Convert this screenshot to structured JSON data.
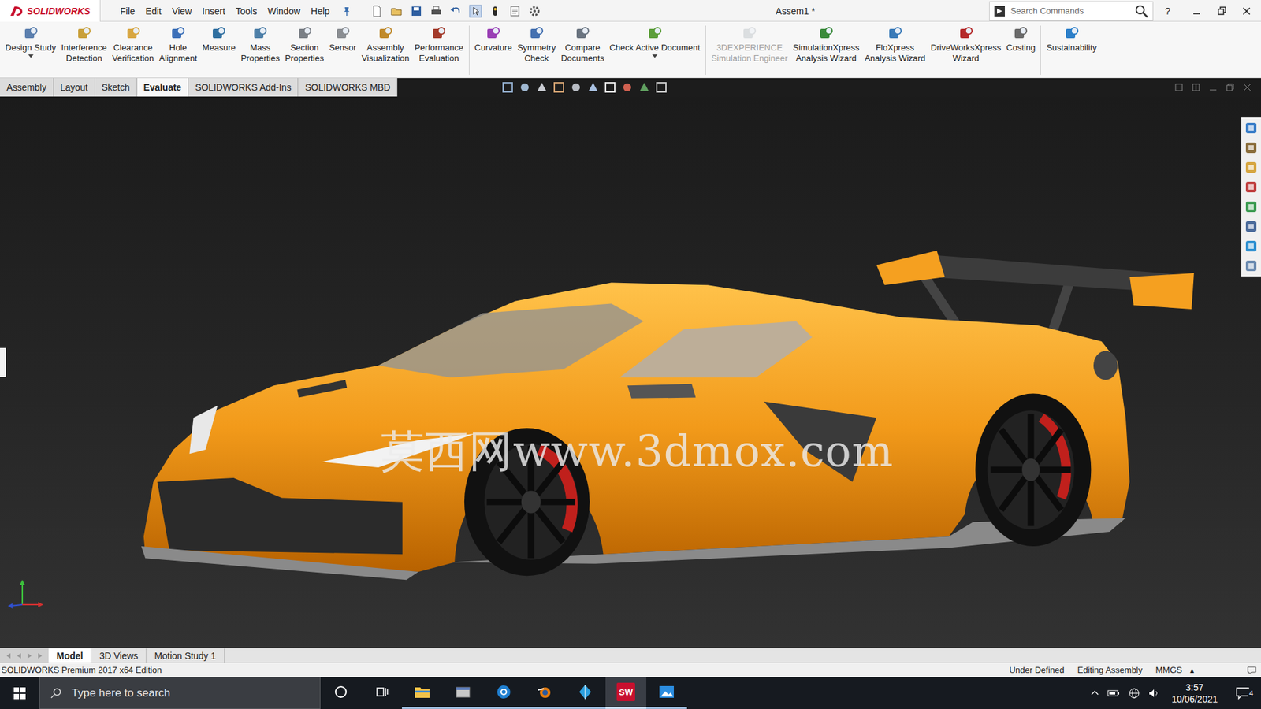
{
  "window": {
    "title": "Assem1 *"
  },
  "logo": {
    "brand": "SOLIDWORKS"
  },
  "menu": [
    {
      "label": "File"
    },
    {
      "label": "Edit"
    },
    {
      "label": "View"
    },
    {
      "label": "Insert"
    },
    {
      "label": "Tools"
    },
    {
      "label": "Window"
    },
    {
      "label": "Help"
    }
  ],
  "search": {
    "placeholder": "Search Commands"
  },
  "help": "?",
  "ribbon": {
    "groups": [
      [
        {
          "lines": [
            "Design Study"
          ],
          "dropdown": true,
          "disabled": false
        },
        {
          "lines": [
            "Interference",
            "Detection"
          ],
          "dropdown": false,
          "disabled": false
        },
        {
          "lines": [
            "Clearance",
            "Verification"
          ],
          "dropdown": false,
          "disabled": false
        },
        {
          "lines": [
            "Hole",
            "Alignment"
          ],
          "dropdown": false,
          "disabled": false
        },
        {
          "lines": [
            "Measure"
          ],
          "dropdown": false,
          "disabled": false
        },
        {
          "lines": [
            "Mass",
            "Properties"
          ],
          "dropdown": false,
          "disabled": false
        },
        {
          "lines": [
            "Section",
            "Properties"
          ],
          "dropdown": false,
          "disabled": false
        },
        {
          "lines": [
            "Sensor"
          ],
          "dropdown": false,
          "disabled": false
        },
        {
          "lines": [
            "Assembly",
            "Visualization"
          ],
          "dropdown": false,
          "disabled": false
        },
        {
          "lines": [
            "Performance",
            "Evaluation"
          ],
          "dropdown": false,
          "disabled": false
        }
      ],
      [
        {
          "lines": [
            "Curvature"
          ],
          "dropdown": false,
          "disabled": false
        },
        {
          "lines": [
            "Symmetry",
            "Check"
          ],
          "dropdown": false,
          "disabled": false
        },
        {
          "lines": [
            "Compare",
            "Documents"
          ],
          "dropdown": false,
          "disabled": false
        },
        {
          "lines": [
            "Check Active Document"
          ],
          "dropdown": true,
          "disabled": false
        }
      ],
      [
        {
          "lines": [
            "3DEXPERIENCE",
            "Simulation Engineer"
          ],
          "dropdown": false,
          "disabled": true
        },
        {
          "lines": [
            "SimulationXpress",
            "Analysis Wizard"
          ],
          "dropdown": false,
          "disabled": false
        },
        {
          "lines": [
            "FloXpress",
            "Analysis Wizard"
          ],
          "dropdown": false,
          "disabled": false
        },
        {
          "lines": [
            "DriveWorksXpress",
            "Wizard"
          ],
          "dropdown": false,
          "disabled": false
        },
        {
          "lines": [
            "Costing"
          ],
          "dropdown": false,
          "disabled": false
        }
      ],
      [
        {
          "lines": [
            "Sustainability"
          ],
          "dropdown": false,
          "disabled": false
        }
      ]
    ]
  },
  "tabs": [
    {
      "label": "Assembly",
      "selected": false
    },
    {
      "label": "Layout",
      "selected": false
    },
    {
      "label": "Sketch",
      "selected": false
    },
    {
      "label": "Evaluate",
      "selected": true
    },
    {
      "label": "SOLIDWORKS Add-Ins",
      "selected": false
    },
    {
      "label": "SOLIDWORKS MBD",
      "selected": false
    }
  ],
  "viewport": {
    "watermark": "莫西网www.3dmox.com"
  },
  "bottom_tabs": [
    {
      "label": "Model",
      "selected": true
    },
    {
      "label": "3D Views",
      "selected": false
    },
    {
      "label": "Motion Study 1",
      "selected": false
    }
  ],
  "status_bar": {
    "edition": "SOLIDWORKS Premium 2017 x64 Edition",
    "fields": [
      "Under Defined",
      "Editing Assembly",
      "MMGS"
    ],
    "units_arrow": "▴"
  },
  "taskbar": {
    "search": "Type here to search",
    "apps": [
      {
        "kind": "cortana",
        "running": false,
        "active": false
      },
      {
        "kind": "taskview",
        "running": false,
        "active": false
      },
      {
        "kind": "explorer",
        "running": true,
        "active": false
      },
      {
        "kind": "files",
        "running": true,
        "active": false
      },
      {
        "kind": "browser",
        "running": true,
        "active": false
      },
      {
        "kind": "blender",
        "running": true,
        "active": false
      },
      {
        "kind": "kite",
        "running": true,
        "active": false
      },
      {
        "kind": "solidworks",
        "label": "SW",
        "running": true,
        "active": true
      },
      {
        "kind": "photos",
        "running": true,
        "active": false
      }
    ],
    "time": "3:57",
    "date": "10/06/2021",
    "notifications": "4"
  }
}
